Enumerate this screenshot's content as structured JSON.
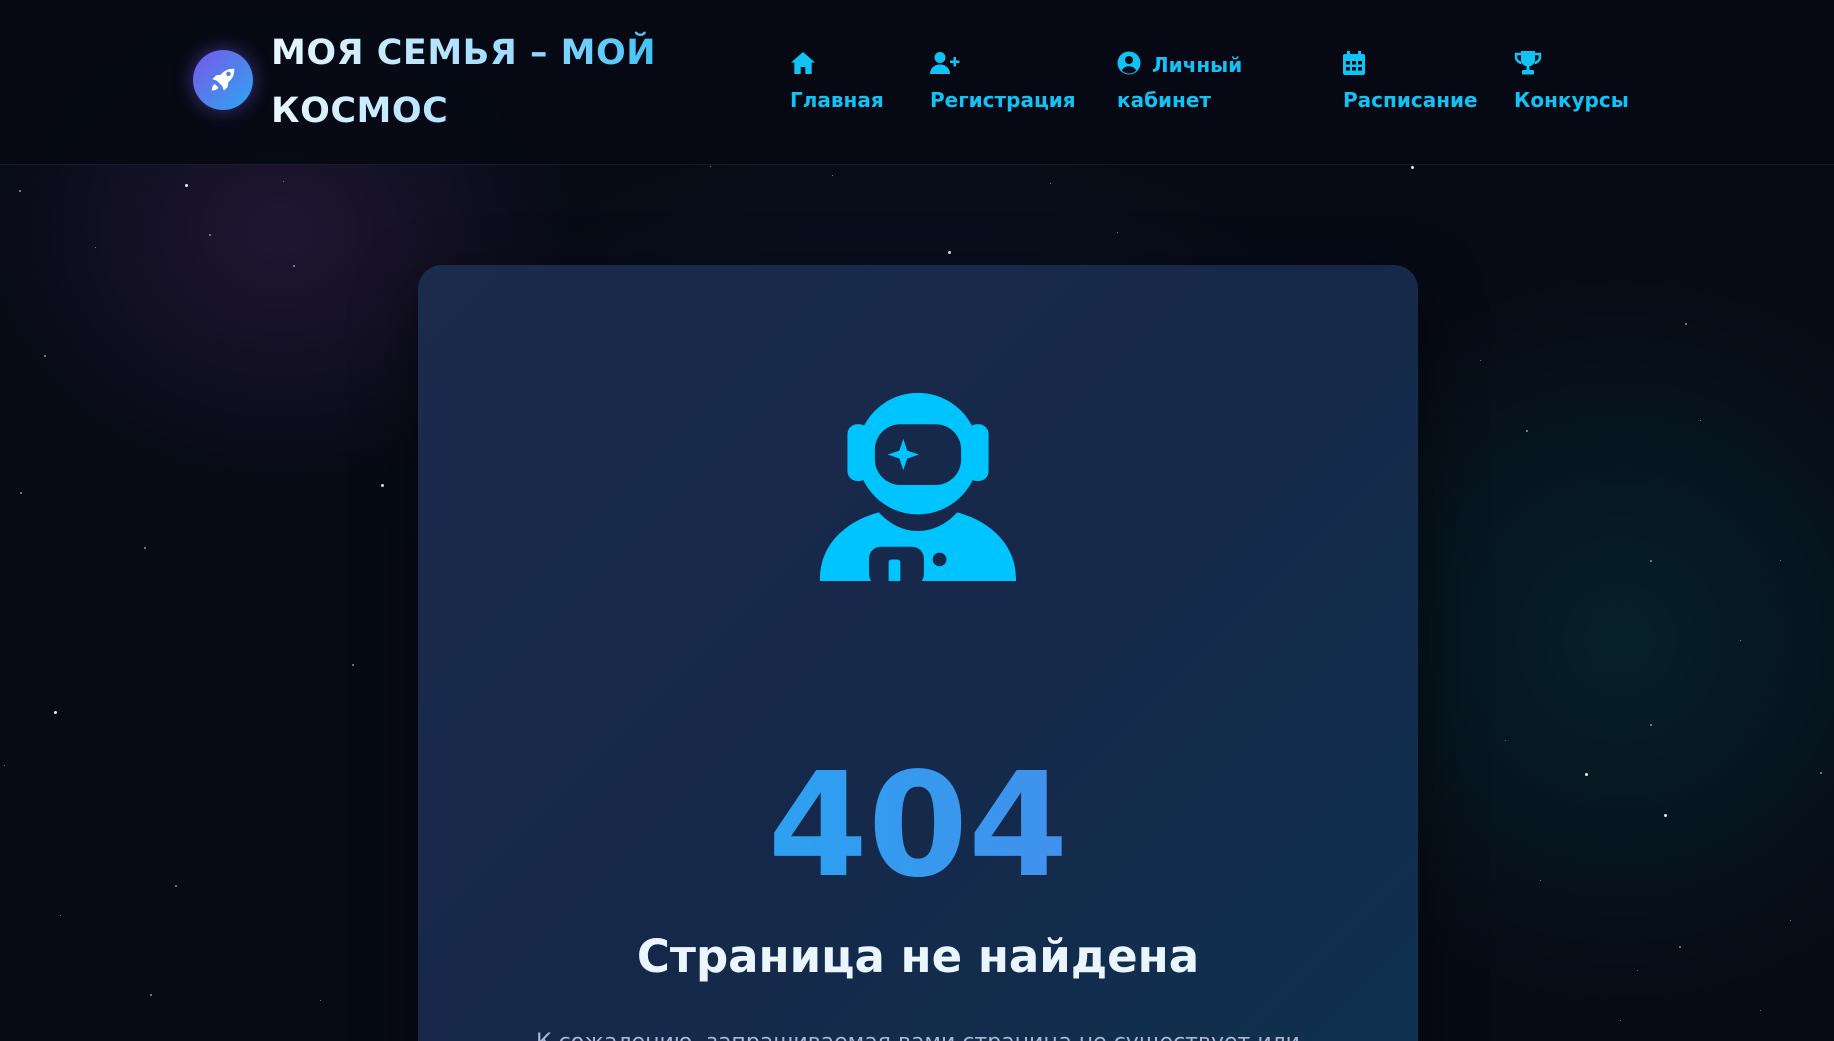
{
  "header": {
    "brand": "МОЯ СЕМЬЯ – МОЙ КОСМОС",
    "logo_icon": "rocket-icon",
    "nav": [
      {
        "label": "Главная",
        "icon": "home-icon"
      },
      {
        "label": "Регистрация",
        "icon": "user-plus-icon"
      },
      {
        "label": "Личный кабинет",
        "icon": "user-circle-icon"
      },
      {
        "label": "Расписание",
        "icon": "calendar-icon"
      },
      {
        "label": "Конкурсы",
        "icon": "trophy-icon"
      }
    ]
  },
  "error": {
    "icon": "astronaut-icon",
    "code": "404",
    "title": "Страница не найдена",
    "description": "К сожалению, запрашиваемая вами страница не существует или"
  },
  "colors": {
    "accent": "#12c2f5",
    "background": "#070b16",
    "card": "#1b2b4c",
    "gradient_end": "#5a7ee8"
  }
}
